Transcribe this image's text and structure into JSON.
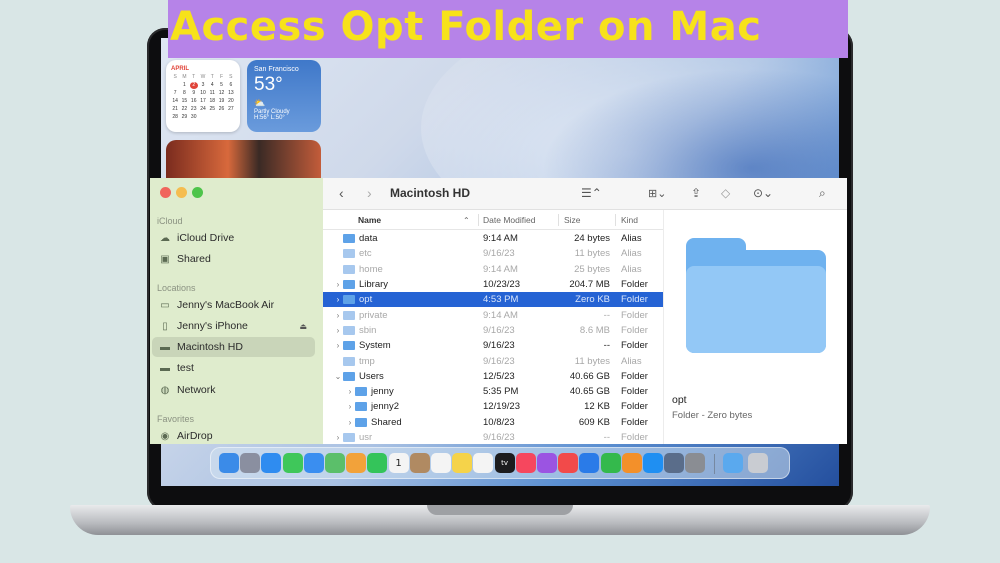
{
  "banner": {
    "title": "Access Opt Folder on Mac"
  },
  "calendar_widget": {
    "month": "APRIL",
    "weekdays": [
      "S",
      "M",
      "T",
      "W",
      "T",
      "F",
      "S"
    ],
    "days": [
      "",
      "1",
      "2",
      "3",
      "4",
      "5",
      "6",
      "7",
      "8",
      "9",
      "10",
      "11",
      "12",
      "13",
      "14",
      "15",
      "16",
      "17",
      "18",
      "19",
      "20",
      "21",
      "22",
      "23",
      "24",
      "25",
      "26",
      "27",
      "28",
      "29",
      "30",
      "",
      "",
      "",
      ""
    ],
    "today": "2"
  },
  "weather_widget": {
    "city": "San Francisco",
    "temp": "53°",
    "icon": "partly-cloudy-icon",
    "condition": "Partly Cloudy",
    "hilo": "H:56° L:50°"
  },
  "finder": {
    "sidebar": {
      "sections": [
        {
          "label": "iCloud"
        },
        {
          "label": "Locations"
        },
        {
          "label": "Favorites"
        }
      ],
      "items": [
        {
          "label": "iCloud Drive",
          "icon": "cloud-icon"
        },
        {
          "label": "Shared",
          "icon": "shared-folder-icon"
        },
        {
          "label": "Jenny's MacBook Air",
          "icon": "laptop-icon"
        },
        {
          "label": "Jenny's iPhone",
          "icon": "phone-icon"
        },
        {
          "label": "Macintosh HD",
          "icon": "drive-icon"
        },
        {
          "label": "test",
          "icon": "drive-icon"
        },
        {
          "label": "Network",
          "icon": "globe-icon"
        },
        {
          "label": "AirDrop",
          "icon": "airdrop-icon"
        }
      ]
    },
    "toolbar": {
      "title": "Macintosh HD"
    },
    "columns": {
      "name": "Name",
      "date": "Date Modified",
      "size": "Size",
      "kind": "Kind"
    },
    "rows": [
      {
        "name": "data",
        "date": "9:14 AM",
        "size": "24 bytes",
        "kind": "Alias"
      },
      {
        "name": "etc",
        "date": "9/16/23",
        "size": "11 bytes",
        "kind": "Alias"
      },
      {
        "name": "home",
        "date": "9:14 AM",
        "size": "25 bytes",
        "kind": "Alias"
      },
      {
        "name": "Library",
        "date": "10/23/23",
        "size": "204.7 MB",
        "kind": "Folder"
      },
      {
        "name": "opt",
        "date": "4:53 PM",
        "size": "Zero KB",
        "kind": "Folder"
      },
      {
        "name": "private",
        "date": "9:14 AM",
        "size": "--",
        "kind": "Folder"
      },
      {
        "name": "sbin",
        "date": "9/16/23",
        "size": "8.6 MB",
        "kind": "Folder"
      },
      {
        "name": "System",
        "date": "9/16/23",
        "size": "--",
        "kind": "Folder"
      },
      {
        "name": "tmp",
        "date": "9/16/23",
        "size": "11 bytes",
        "kind": "Alias"
      },
      {
        "name": "Users",
        "date": "12/5/23",
        "size": "40.66 GB",
        "kind": "Folder"
      },
      {
        "name": "jenny",
        "date": "5:35 PM",
        "size": "40.65 GB",
        "kind": "Folder"
      },
      {
        "name": "jenny2",
        "date": "12/19/23",
        "size": "12 KB",
        "kind": "Folder"
      },
      {
        "name": "Shared",
        "date": "10/8/23",
        "size": "609 KB",
        "kind": "Folder"
      },
      {
        "name": "usr",
        "date": "9/16/23",
        "size": "--",
        "kind": "Folder"
      }
    ],
    "preview": {
      "name": "opt",
      "kind": "Folder - Zero bytes"
    }
  },
  "dock": {
    "icons": [
      {
        "name": "finder-icon",
        "color": "#3b8be8"
      },
      {
        "name": "launchpad-icon",
        "color": "#8a8fa0"
      },
      {
        "name": "safari-icon",
        "color": "#2f8cf0"
      },
      {
        "name": "messages-icon",
        "color": "#3fc75a"
      },
      {
        "name": "mail-icon",
        "color": "#3a8ef0"
      },
      {
        "name": "maps-icon",
        "color": "#5bbf6a"
      },
      {
        "name": "photos-icon",
        "color": "#f2a23a"
      },
      {
        "name": "facetime-icon",
        "color": "#34c45a"
      },
      {
        "name": "calendar-icon",
        "color": "#f4f4f4"
      },
      {
        "name": "contacts-icon",
        "color": "#b08a62"
      },
      {
        "name": "reminders-icon",
        "color": "#f4f4f4"
      },
      {
        "name": "notes-icon",
        "color": "#f5d34a"
      },
      {
        "name": "freeform-icon",
        "color": "#f4f4f4"
      },
      {
        "name": "tv-icon",
        "color": "#1c1c1e"
      },
      {
        "name": "music-icon",
        "color": "#f6475e"
      },
      {
        "name": "podcasts-icon",
        "color": "#9b54e2"
      },
      {
        "name": "news-icon",
        "color": "#f24a4a"
      },
      {
        "name": "keynote-icon",
        "color": "#2a7be8"
      },
      {
        "name": "numbers-icon",
        "color": "#34b94c"
      },
      {
        "name": "pages-icon",
        "color": "#f3902a"
      },
      {
        "name": "app-store-icon",
        "color": "#1f8ff2"
      },
      {
        "name": "iphone-mirroring-icon",
        "color": "#5a6d8a"
      },
      {
        "name": "system-settings-icon",
        "color": "#8a8d93"
      },
      {
        "name": "downloads-folder-icon",
        "color": "#5aa9ee"
      },
      {
        "name": "trash-icon",
        "color": "#c9ccd2"
      }
    ],
    "calendar_day": "1",
    "tv_label": "tv"
  }
}
